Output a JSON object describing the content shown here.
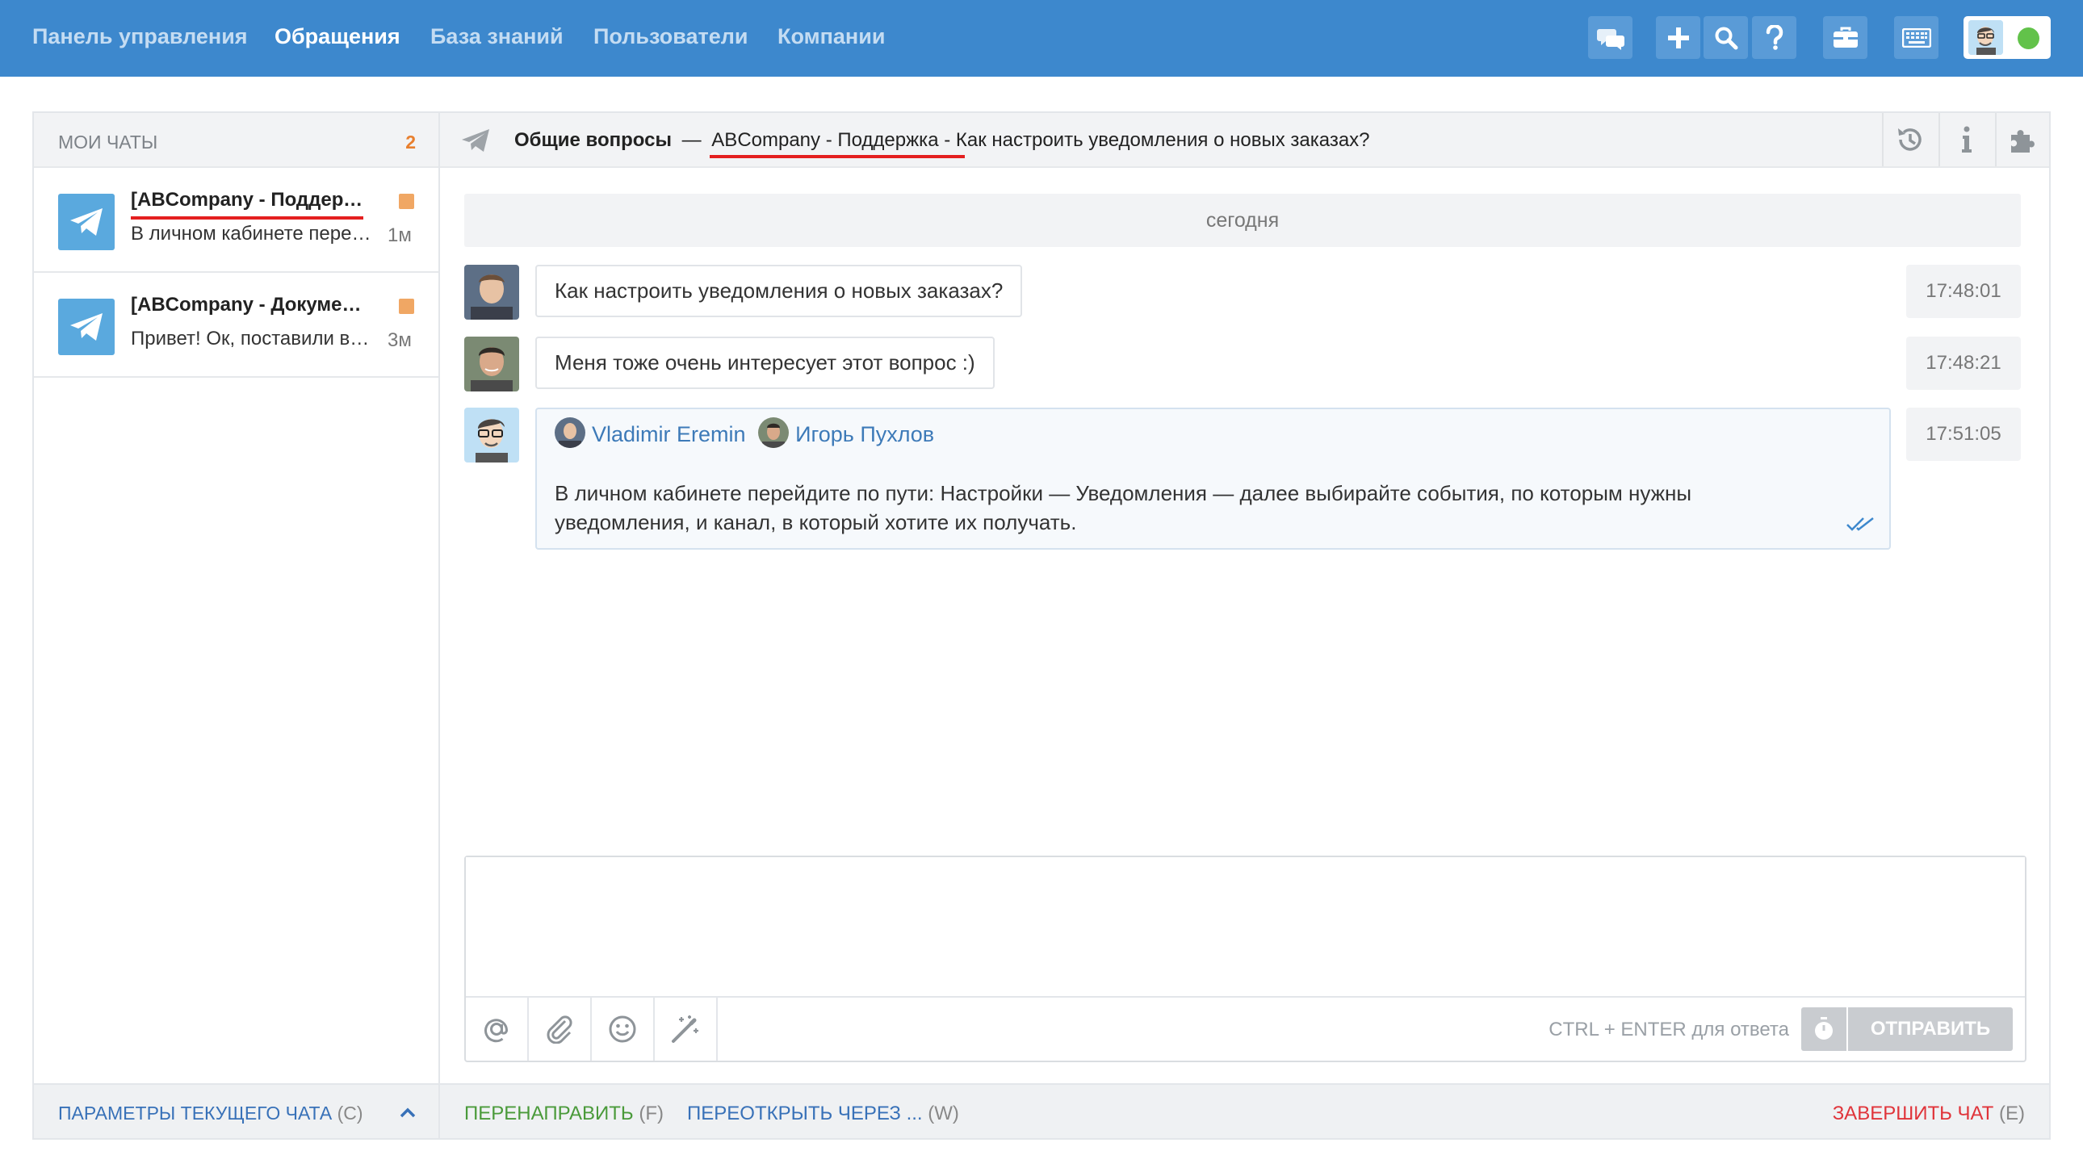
{
  "nav": {
    "links": [
      "Панель управления",
      "Обращения",
      "База знаний",
      "Пользователи",
      "Компании"
    ],
    "active_index": 1
  },
  "toolbar_icons": [
    "chats-icon",
    "plus-icon",
    "search-icon",
    "help-icon",
    "briefcase-icon",
    "keyboard-icon"
  ],
  "user": {
    "status_color": "#62c24a"
  },
  "sidebar": {
    "title": "МОИ ЧАТЫ",
    "count": "2",
    "chats": [
      {
        "title": "[ABCompany - Поддержка] Как настроить уведомления о новых заказах?",
        "snippet": "В личном кабинете перейдите по пути: Настройки",
        "time": "1м",
        "unread_color": "#f0a764"
      },
      {
        "title": "[ABCompany - Документы]",
        "snippet": "Привет! Ок, поставили в работу",
        "time": "3м",
        "unread_color": "#f0a764"
      }
    ],
    "footer": {
      "label": "ПАРАМЕТРЫ ТЕКУЩЕГО ЧАТА",
      "key": "(C)"
    }
  },
  "conversation": {
    "header": {
      "category": "Общие вопросы",
      "separator": "—",
      "channel": "ABCompany - Поддержка",
      "subject": " - Как настроить уведомления о новых заказах?"
    },
    "date_label": "сегодня",
    "messages": [
      {
        "text": "Как настроить уведомления о новых заказах?",
        "time": "17:48:01"
      },
      {
        "text": "Меня тоже очень интересует этот вопрос :)",
        "time": "17:48:21"
      }
    ],
    "operator_message": {
      "recipients": [
        "Vladimir Eremin",
        "Игорь Пухлов"
      ],
      "text": "В личном кабинете перейдите по пути: Настройки — Уведомления — далее выбирайте события, по которым нужны\nуведомления, и канал, в который хотите их получать.",
      "time": "17:51:05"
    },
    "composer": {
      "placeholder": "",
      "hint": "CTRL + ENTER для ответа",
      "send_label": "ОТПРАВИТЬ"
    },
    "footer": {
      "forward": {
        "label": "ПЕРЕНАПРАВИТЬ",
        "key": "(F)",
        "color": "#4a9a3a"
      },
      "reopen": {
        "label": "ПЕРЕОТКРЫТЬ ЧЕРЕЗ ...",
        "key": "(W)",
        "color": "#3871b8"
      },
      "finish": {
        "label": "ЗАВЕРШИТЬ ЧАТ",
        "key": "(E)",
        "color": "#e0343a"
      }
    }
  },
  "colors": {
    "topbar": "#3d88cd",
    "accent_link": "#3871b8",
    "unread": "#f0a764",
    "underline_mark": "#e41f1f"
  }
}
